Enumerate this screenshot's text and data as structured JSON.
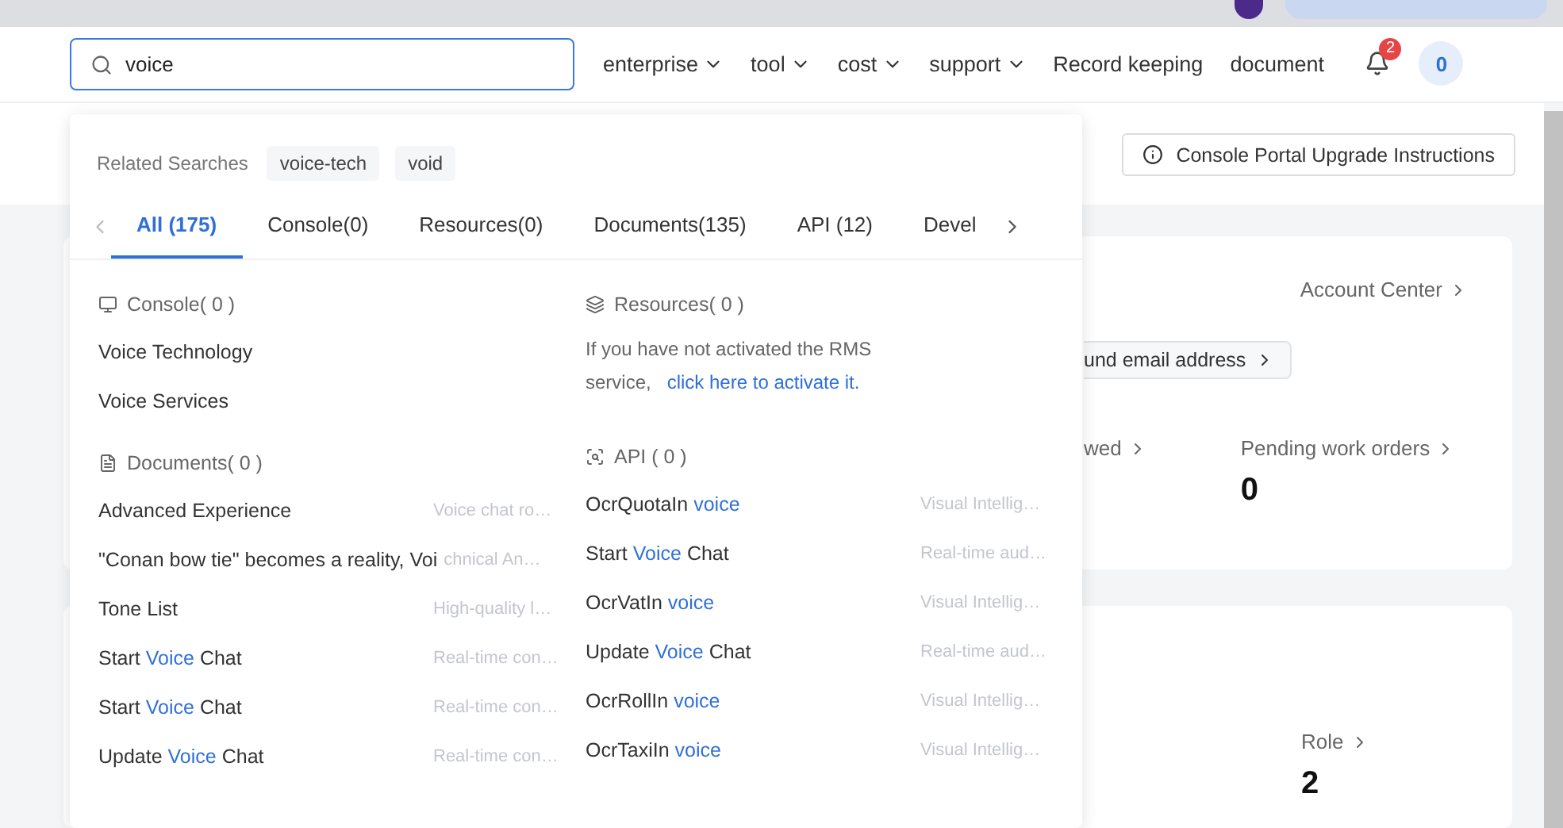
{
  "search": {
    "value": "voice"
  },
  "nav": [
    {
      "label": "enterprise",
      "kind": "menu"
    },
    {
      "label": "tool",
      "kind": "menu"
    },
    {
      "label": "cost",
      "kind": "menu"
    },
    {
      "label": "support",
      "kind": "menu"
    },
    {
      "label": "Record keeping",
      "kind": "link"
    },
    {
      "label": "document",
      "kind": "link"
    }
  ],
  "notifications": {
    "badge": "2"
  },
  "avatar": {
    "label": "0"
  },
  "dropdown": {
    "related_label": "Related Searches",
    "related": [
      "voice-tech",
      "void"
    ],
    "tabs": [
      {
        "label": "All (175)",
        "selected": true
      },
      {
        "label": "Console(0)",
        "selected": false
      },
      {
        "label": "Resources(0)",
        "selected": false
      },
      {
        "label": "Documents(135)",
        "selected": false
      },
      {
        "label": "API (12)",
        "selected": false
      },
      {
        "label": "Devel",
        "selected": false
      }
    ],
    "columns": [
      [
        {
          "kind": "console",
          "title": "Console( 0 )",
          "items": [
            {
              "title": "Voice Technology"
            },
            {
              "title": "Voice Services"
            }
          ]
        },
        {
          "kind": "documents",
          "title": "Documents( 0 )",
          "items": [
            {
              "title": "Advanced Experience",
              "description": "Voice chat ro…"
            },
            {
              "title": "\"Conan bow tie\" becomes a reality, Voi",
              "description": "chnical An…"
            },
            {
              "title": "Tone List",
              "description": "High-quality l…"
            },
            {
              "title": "Start **Voice** Chat",
              "description": "Real-time con…"
            },
            {
              "title": "Start **Voice** Chat",
              "description": "Real-time con…"
            },
            {
              "title": "Update **Voice** Chat",
              "description": "Real-time con…"
            }
          ]
        }
      ],
      [
        {
          "kind": "resources",
          "title": "Resources( 0 )",
          "notice": {
            "text": "If you have not activated the RMS service,",
            "link": "click here to activate it."
          }
        },
        {
          "kind": "api",
          "title": "API ( 0 )",
          "items": [
            {
              "title": "OcrQuotaIn **voice**",
              "description": "Visual Intellig…"
            },
            {
              "title": "Start **Voice** Chat",
              "description": "Real-time aud…"
            },
            {
              "title": "OcrVatIn **voice**",
              "description": "Visual Intellig…"
            },
            {
              "title": "Update **Voice** Chat",
              "description": "Real-time aud…"
            },
            {
              "title": "OcrRollIn **voice**",
              "description": "Visual Intellig…"
            },
            {
              "title": "OcrTaxiIn **voice**",
              "description": "Visual Intellig…"
            }
          ]
        }
      ]
    ]
  },
  "upgrade_button": "Console Portal Upgrade Instructions",
  "account_card": {
    "account_center": "Account Center",
    "email_button": "und email address",
    "reviewed": "wed",
    "pending_label": "Pending work orders",
    "pending_value": "0"
  },
  "role_card": {
    "label": "Role",
    "value": "2"
  }
}
